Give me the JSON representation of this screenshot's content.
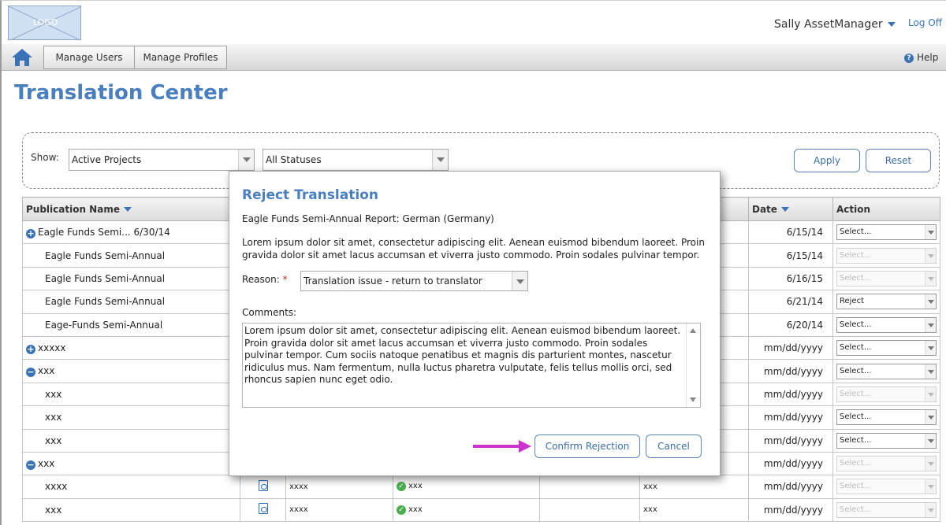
{
  "header": {
    "logo_text": "LOGO",
    "user_name": "Sally AssetManager",
    "logoff_label": "Log Off"
  },
  "nav": {
    "items": [
      {
        "label": "Manage Users"
      },
      {
        "label": "Manage Profiles"
      }
    ],
    "help_label": "Help"
  },
  "page": {
    "title": "Translation Center"
  },
  "filters": {
    "show_label": "Show:",
    "project_value": "Active Projects",
    "status_value": "All Statuses",
    "apply_label": "Apply",
    "reset_label": "Reset"
  },
  "table": {
    "headers": {
      "publication": "Publication Name",
      "date": "Date",
      "action": "Action"
    },
    "rows": [
      {
        "name": "Eagle Funds Semi... 6/30/14",
        "expander": "+",
        "date": "6/15/14",
        "action": "Select...",
        "action_enabled": true
      },
      {
        "name": "Eagle Funds Semi-Annual",
        "date": "6/15/14",
        "action": "Select...",
        "action_enabled": false
      },
      {
        "name": "Eagle Funds Semi-Annual",
        "date": "6/16/15",
        "action": "Select...",
        "action_enabled": false
      },
      {
        "name": "Eagle Funds Semi-Annual",
        "date": "6/21/14",
        "action": "Reject",
        "action_enabled": true
      },
      {
        "name": "Eage-Funds Semi-Annual",
        "date": "6/20/14",
        "action": "Select...",
        "action_enabled": true
      },
      {
        "name": "xxxxx",
        "expander": "+",
        "date": "mm/dd/yyyy",
        "action": "Select...",
        "action_enabled": true
      },
      {
        "name": "xxx",
        "expander": "−",
        "date": "mm/dd/yyyy",
        "action": "Select...",
        "action_enabled": true
      },
      {
        "name": "xxx",
        "date": "mm/dd/yyyy",
        "action": "Select...",
        "action_enabled": false
      },
      {
        "name": "xxx",
        "date": "mm/dd/yyyy",
        "action": "Select...",
        "action_enabled": true
      },
      {
        "name": "xxx",
        "date": "mm/dd/yyyy",
        "action": "Select...",
        "action_enabled": true
      },
      {
        "name": "xxx",
        "expander": "−",
        "date": "mm/dd/yyyy",
        "action": "Select...",
        "action_enabled": false
      },
      {
        "name": "xxxx",
        "c2": "xxxx",
        "c3": "xxx",
        "c5": "xxx",
        "date": "mm/dd/yyyy",
        "action": "Select...",
        "action_enabled": false
      },
      {
        "name": "xxx",
        "c2": "xxxx",
        "c3": "xxx",
        "c5": "xxx",
        "date": "mm/dd/yyyy",
        "action": "Select...",
        "action_enabled": false
      }
    ]
  },
  "modal": {
    "title": "Reject Translation",
    "subtitle": "Eagle Funds Semi-Annual Report: German (Germany)",
    "description": "Lorem ipsum dolor sit amet, consectetur adipiscing elit. Aenean euismod bibendum laoreet. Proin gravida dolor sit amet lacus accumsan et viverra justo commodo. Proin sodales pulvinar tempor.",
    "reason_label": "Reason:",
    "reason_required": "*",
    "reason_value": "Translation issue - return to translator",
    "comments_label": "Comments:",
    "comments_value": "Lorem ipsum dolor sit amet, consectetur adipiscing elit. Aenean euismod bibendum laoreet. Proin gravida dolor sit amet lacus accumsan et viverra justo commodo. Proin sodales pulvinar tempor. Cum sociis natoque penatibus et magnis dis parturient montes, nascetur ridiculus mus. Nam fermentum, nulla luctus pharetra vulputate, felis tellus mollis orci, sed rhoncus sapien nunc eget odio.",
    "confirm_label": "Confirm Rejection",
    "cancel_label": "Cancel"
  },
  "colors": {
    "accent": "#4a7fbf",
    "annotation_arrow": "#cc33cc"
  }
}
